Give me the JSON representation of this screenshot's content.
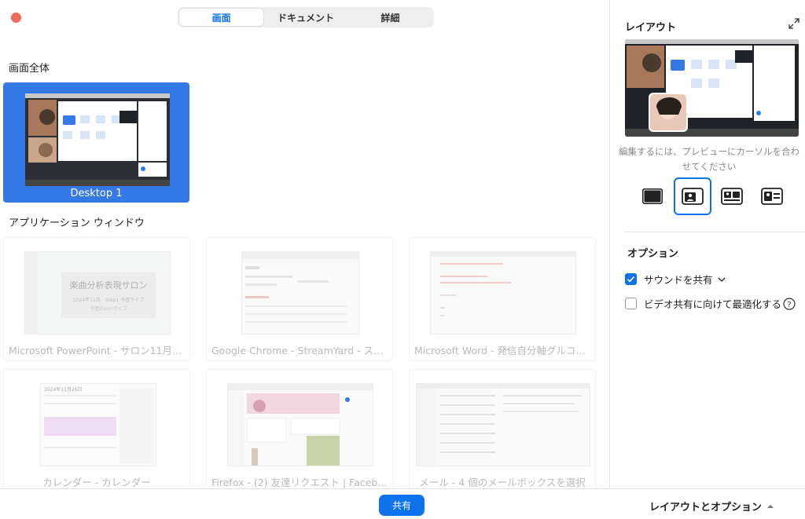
{
  "tabs": [
    {
      "label": "画面",
      "active": true
    },
    {
      "label": "ドキュメント",
      "active": false
    },
    {
      "label": "詳細",
      "active": false
    }
  ],
  "sections": {
    "full_screen": "画面全体",
    "app_windows": "アプリケーション ウィンドウ"
  },
  "desktop": {
    "label": "Desktop 1"
  },
  "app_windows": [
    {
      "label": "Microsoft PowerPoint - サロン11月…",
      "thumb_title": "楽曲分析表現サロン",
      "thumb_sub1": "2024年11月　Step1 予習ライブ",
      "thumb_sub2": "予習Zoomライブ"
    },
    {
      "label": "Google Chrome - StreamYard - ス…"
    },
    {
      "label": "Microsoft Word - 発信自分軸グルコ…"
    },
    {
      "label": "カレンダー - カレンダー",
      "thumb_title": "2024年11月26日"
    },
    {
      "label": "Firefox - (2) 友達リクエスト | Faceb…"
    },
    {
      "label": "メール - 4 個のメールボックスを選択"
    }
  ],
  "right_panel": {
    "layout_title": "レイアウト",
    "hint": "編集するには、プレビューにカーソルを合わせてください",
    "options_title": "オプション",
    "options": [
      {
        "label": "サウンドを共有",
        "checked": true
      },
      {
        "label": "ビデオ共有に向けて最適化する",
        "checked": false
      }
    ]
  },
  "bottom": {
    "share_label": "共有",
    "layout_toggle_label": "レイアウトとオプション"
  },
  "colors": {
    "accent": "#0e72ed",
    "selected_card": "#3479e6",
    "close_dot": "#ec6a5e"
  }
}
